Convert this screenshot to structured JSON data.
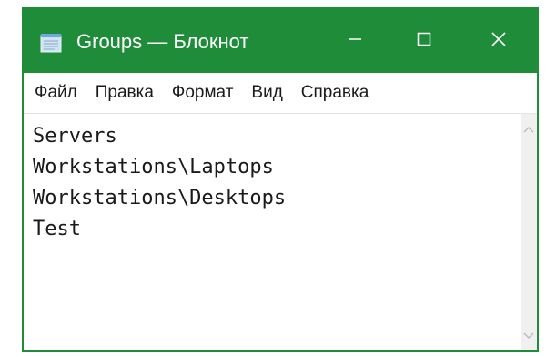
{
  "window": {
    "title": "Groups — Блокнот",
    "accent_color": "#1f8c3a",
    "app_icon": "notepad-icon",
    "controls": {
      "minimize": "minimize-icon",
      "maximize": "maximize-icon",
      "close": "close-icon"
    }
  },
  "menu": {
    "items": [
      {
        "label": "Файл"
      },
      {
        "label": "Правка"
      },
      {
        "label": "Формат"
      },
      {
        "label": "Вид"
      },
      {
        "label": "Справка"
      }
    ]
  },
  "editor": {
    "lines": [
      "Servers",
      "Workstations\\Laptops",
      "Workstations\\Desktops",
      "Test"
    ]
  },
  "scrollbar": {
    "up_icon": "chevron-up-icon",
    "down_icon": "chevron-down-icon"
  }
}
